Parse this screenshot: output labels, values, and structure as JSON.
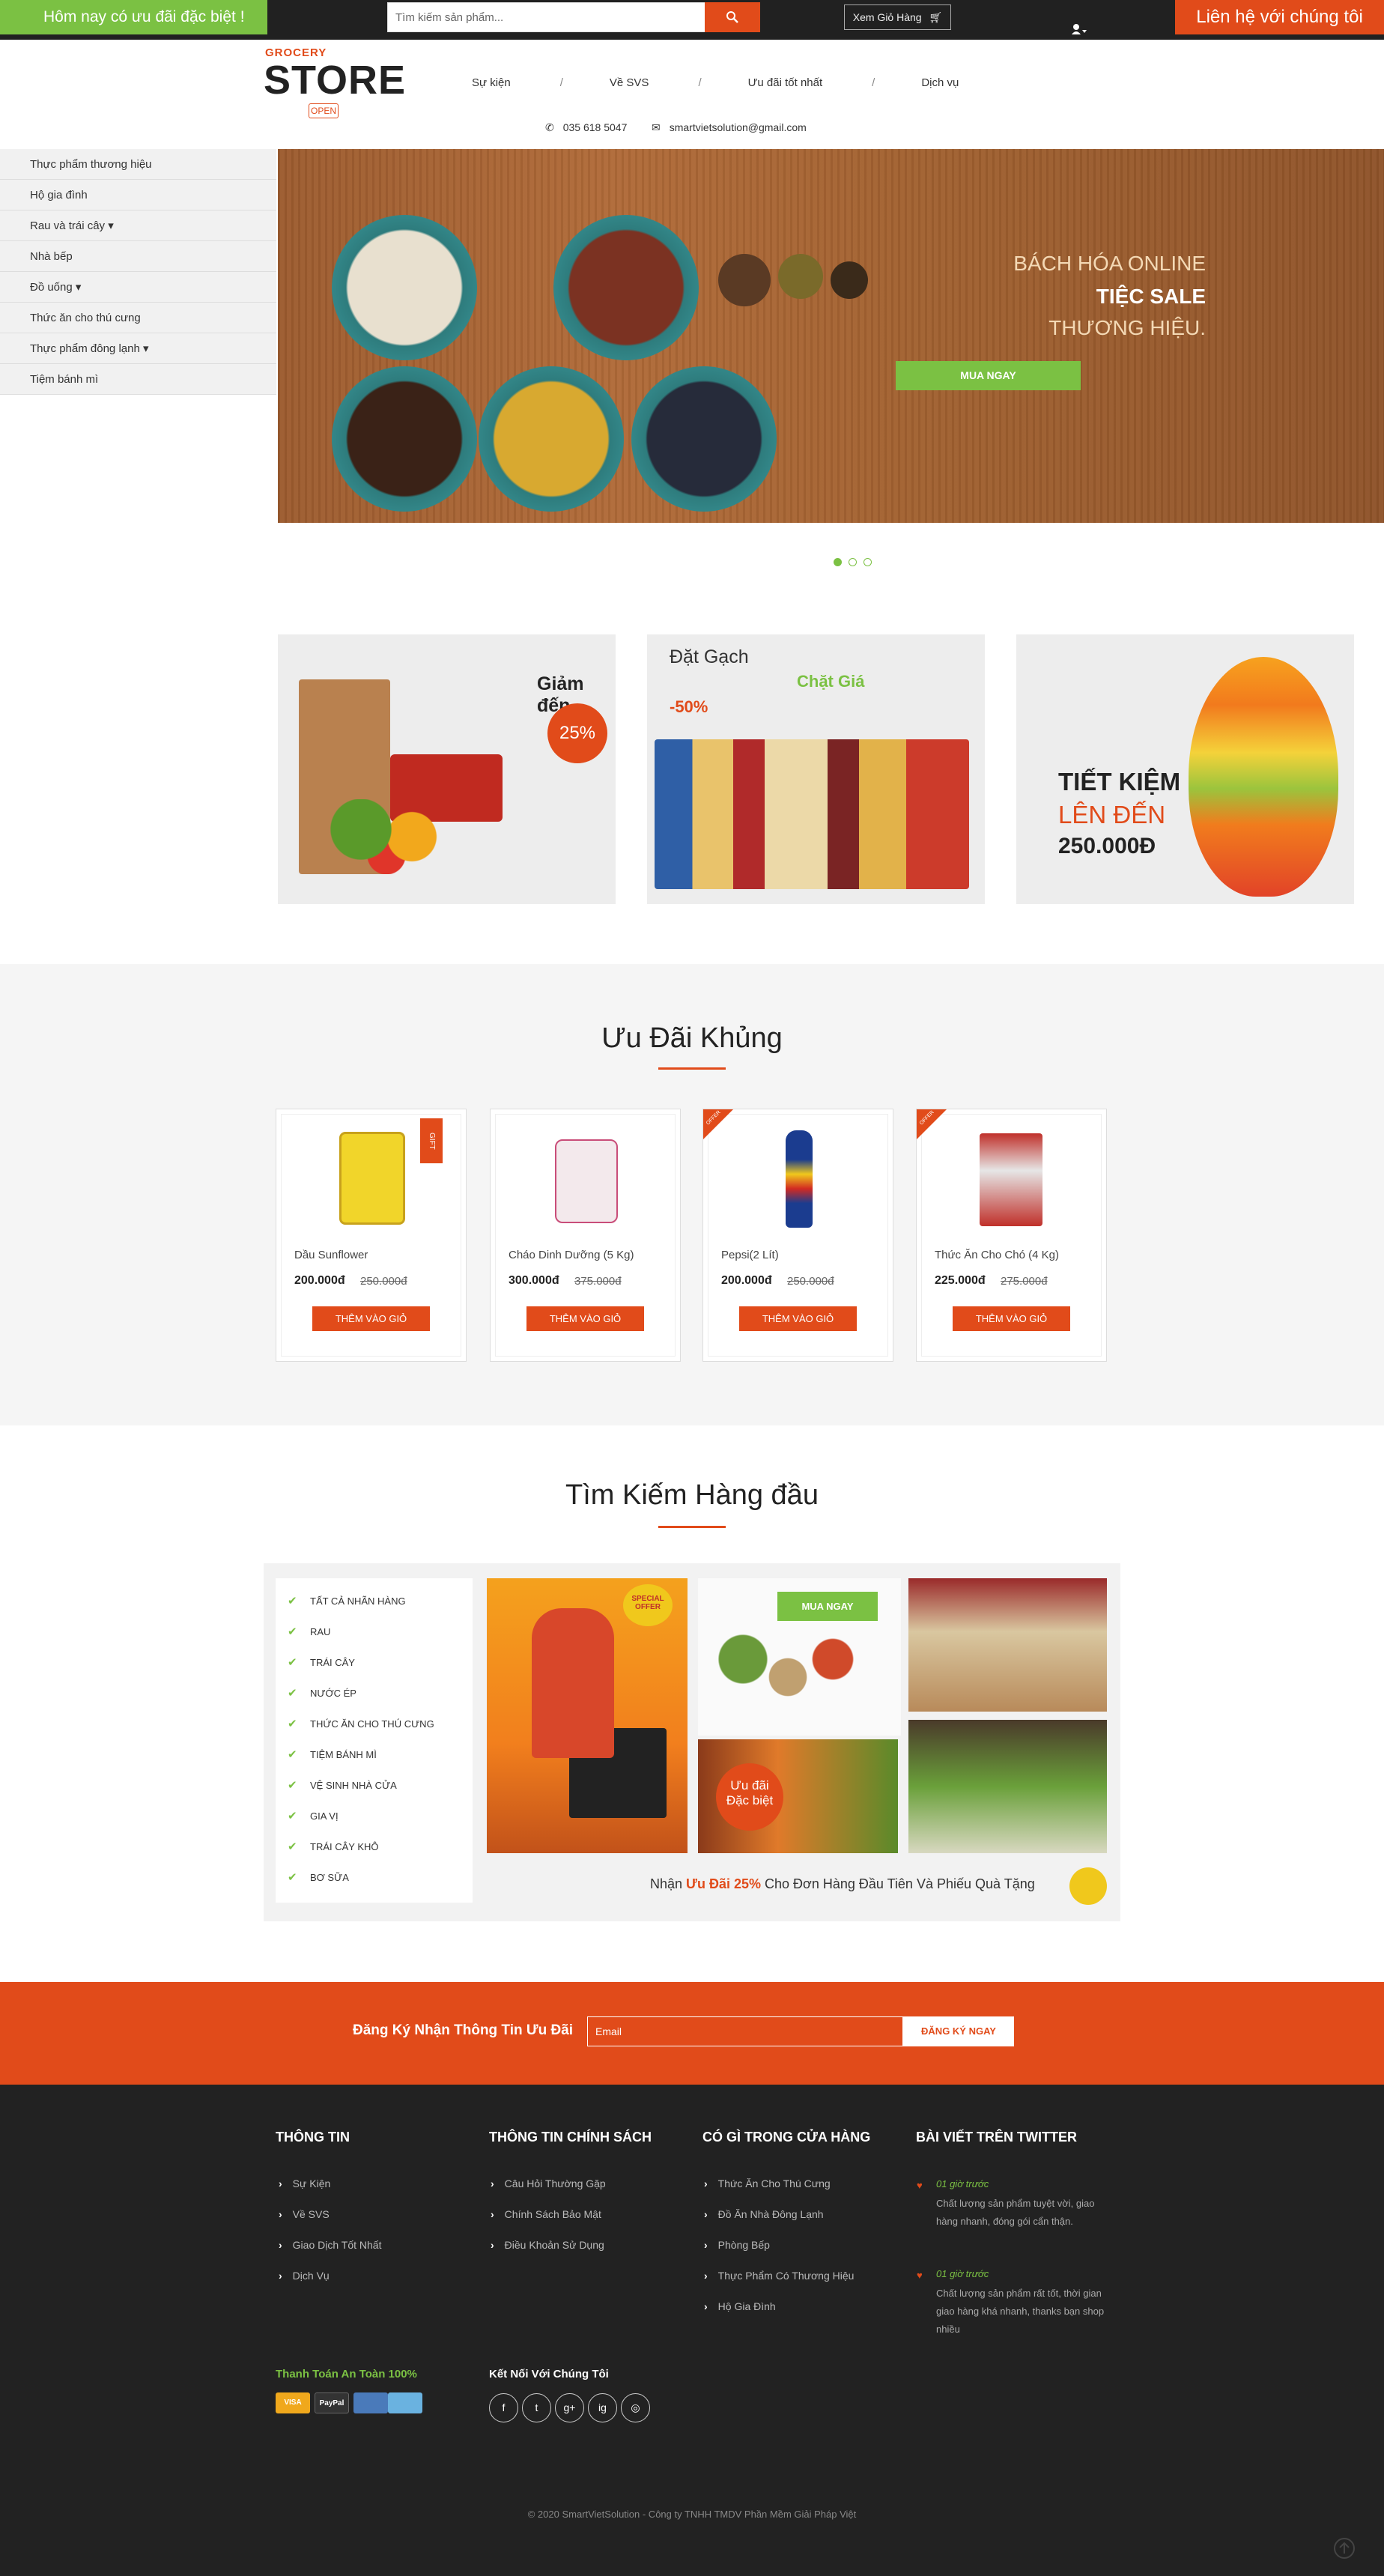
{
  "topbar": {
    "special_label": "Hôm nay có ưu đãi đặc biệt !",
    "search_placeholder": "Tìm kiếm sản phẩm...",
    "cart_label": "Xem Giỏ Hàng",
    "contact_label": "Liên hệ với chúng tôi"
  },
  "header": {
    "logo_top": "GROCERY",
    "logo_main": "STORE",
    "logo_badge": "OPEN",
    "nav": [
      "Sự kiện",
      "Về SVS",
      "Ưu đãi tốt nhất",
      "Dịch vụ"
    ],
    "phone": "035 618 5047",
    "email": "smartvietsolution@gmail.com"
  },
  "sidebar": {
    "items": [
      {
        "label": "Thực phẩm thương hiệu"
      },
      {
        "label": "Hộ gia đình"
      },
      {
        "label": "Rau và trái cây ▾"
      },
      {
        "label": "Nhà bếp"
      },
      {
        "label": "Đồ uống ▾"
      },
      {
        "label": "Thức ăn cho thú cưng"
      },
      {
        "label": "Thực phẩm đông lạnh ▾"
      },
      {
        "label": "Tiệm bánh mì"
      }
    ]
  },
  "banner": {
    "line1": "BÁCH HÓA ONLINE",
    "line2": "TIỆC SALE",
    "line3": "THƯƠNG HIỆU.",
    "button": "MUA NGAY"
  },
  "promos": {
    "p1_text": "Giảm đến",
    "p1_badge": "25%",
    "p2_title": "Đặt Gạch",
    "p2_sub": "Chặt Giá",
    "p2_pct": "-50%",
    "p3_line1": "TIẾT KIỆM",
    "p3_line2": "LÊN ĐẾN",
    "p3_line3": "250.000Đ"
  },
  "deals": {
    "title": "Ưu Đãi Khủng",
    "products": [
      {
        "name": "Dầu Sunflower",
        "price": "200.000đ",
        "old_price": "250.000đ",
        "button": "THÊM VÀO GIỎ",
        "tag": "GIFT"
      },
      {
        "name": "Cháo Dinh Dưỡng (5 Kg)",
        "price": "300.000đ",
        "old_price": "375.000đ",
        "button": "THÊM VÀO GIỎ",
        "tag": ""
      },
      {
        "name": "Pepsi(2 Lít)",
        "price": "200.000đ",
        "old_price": "250.000đ",
        "button": "THÊM VÀO GIỎ",
        "tag": "OFFER"
      },
      {
        "name": "Thức Ăn Cho Chó (4 Kg)",
        "price": "225.000đ",
        "old_price": "275.000đ",
        "button": "THÊM VÀO GIỎ",
        "tag": "OFFER"
      }
    ]
  },
  "top_search": {
    "title": "Tìm Kiếm Hàng đầu",
    "categories": [
      "TẤT CẢ NHÃN HÀNG",
      "RAU",
      "TRÁI CÂY",
      "NƯỚC ÉP",
      "THỨC ĂN CHO THÚ CƯNG",
      "TIỆM BÁNH MÌ",
      "VỆ SINH NHÀ CỬA",
      "GIA VỊ",
      "TRÁI CÂY KHÔ",
      "BƠ SỮA"
    ],
    "special_offer": "SPECIAL OFFER",
    "buy_now": "MUA NGAY",
    "deal_line1": "Ưu đãi",
    "deal_line2": "Đặc biệt",
    "note_prefix": "Nhận",
    "note_highlight": "Ưu Đãi 25%",
    "note_suffix": "Cho Đơn Hàng Đầu Tiên Và Phiếu Quà Tặng"
  },
  "subscribe": {
    "label": "Đăng Ký Nhận Thông Tin Ưu Đãi",
    "placeholder": "Email",
    "button": "ĐĂNG KÝ NGAY"
  },
  "footer": {
    "col1": {
      "title": "THÔNG TIN",
      "links": [
        "Sự Kiện",
        "Về SVS",
        "Giao Dịch Tốt Nhất",
        "Dịch Vụ"
      ]
    },
    "col2": {
      "title": "THÔNG TIN CHÍNH SÁCH",
      "links": [
        "Câu Hỏi Thường Gặp",
        "Chính Sách Bảo Mật",
        "Điều Khoản Sử Dụng"
      ]
    },
    "col3": {
      "title": "CÓ GÌ TRONG CỬA HÀNG",
      "links": [
        "Thức Ăn Cho Thú Cưng",
        "Đồ Ăn Nhà Đông Lạnh",
        "Phòng Bếp",
        "Thực Phẩm Có Thương Hiệu",
        "Hộ Gia Đình"
      ]
    },
    "col4": {
      "title": "BÀI VIẾT TRÊN TWITTER",
      "tweets": [
        {
          "author": "01 giờ trước",
          "text": "Chất lượng sản phẩm tuyệt vời, giao hàng nhanh, đóng gói cẩn thận."
        },
        {
          "author": "01 giờ trước",
          "text": "Chất lượng sản phẩm rất tốt, thời gian giao hàng khá nhanh, thanks bạn shop nhiều"
        }
      ]
    },
    "payment_title": "Thanh Toán An Toàn 100%",
    "payment_cards": [
      "VISA",
      "PayPal",
      "",
      ""
    ],
    "social_title": "Kết Nối Với Chúng Tôi",
    "social_icons": [
      "f",
      "t",
      "g+",
      "ig",
      "◎"
    ],
    "copyright": "© 2020 SmartVietSolution - Công ty TNHH TMDV Phần Mềm Giải Pháp Việt"
  }
}
